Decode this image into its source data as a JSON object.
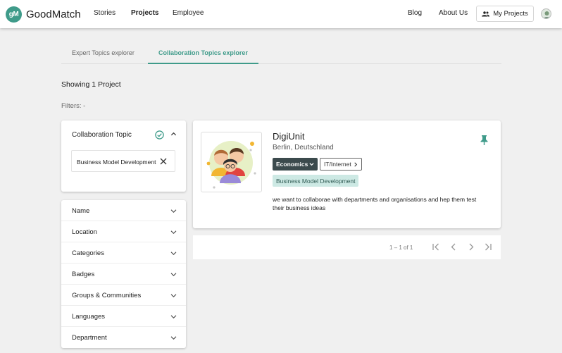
{
  "header": {
    "logo_mark": "gM",
    "logo_text": "GoodMatch",
    "nav_left": [
      "Stories",
      "Projects",
      "Employee"
    ],
    "nav_right": [
      "Blog",
      "About Us"
    ],
    "my_projects_label": "My Projects",
    "accent_color": "#3f9b8a"
  },
  "tabs": {
    "expert": "Expert Topics explorer",
    "collaboration": "Collaboration Topics explorer",
    "active": "collaboration"
  },
  "summary": {
    "showing": "Showing 1 Project",
    "filters": "Filters:  -"
  },
  "collab_topic": {
    "title": "Collaboration Topic",
    "selected_chip": "Business Model Development",
    "icons": [
      "check-circle-icon",
      "chevron-up-icon",
      "close-icon"
    ]
  },
  "filter_list": [
    "Name",
    "Location",
    "Categories",
    "Badges",
    "Groups & Communities",
    "Languages",
    "Department"
  ],
  "project": {
    "name": "DigiUnit",
    "location": "Berlin, Deutschland",
    "tag_primary": "Economics",
    "tag_secondary": "IT/Internet",
    "collab_tag": "Business Model Development",
    "description": "we want to collaborae with departments and organisations and hep them test their business ideas",
    "icons": [
      "pin-icon",
      "team-illustration"
    ]
  },
  "pagination": {
    "range": "1 – 1 of 1",
    "icons": [
      "first-page-icon",
      "prev-page-icon",
      "next-page-icon",
      "last-page-icon"
    ]
  }
}
